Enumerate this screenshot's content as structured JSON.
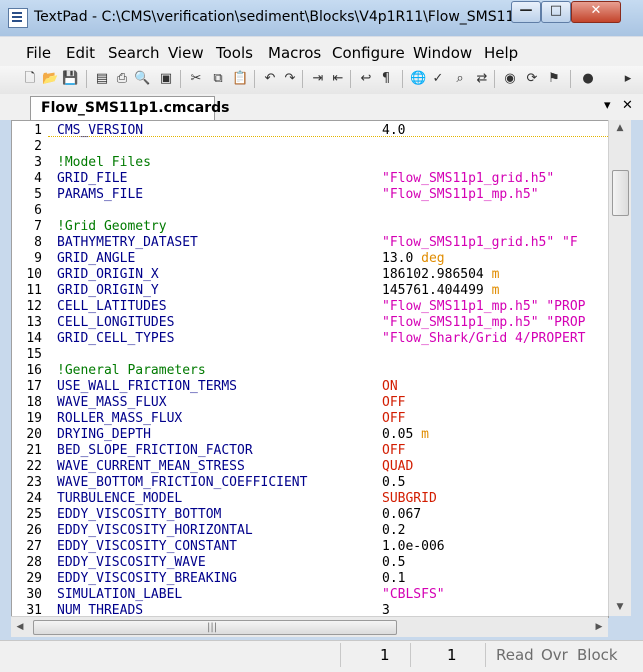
{
  "window": {
    "title": "TextPad - C:\\CMS\\verification\\sediment\\Blocks\\V4p1R11\\Flow_SMS11...",
    "controls": {
      "minimize": "—",
      "maximize": "□",
      "close": "✕"
    }
  },
  "menu": [
    "File",
    "Edit",
    "Search",
    "View",
    "Tools",
    "Macros",
    "Configure",
    "Window",
    "Help"
  ],
  "toolbar": [
    {
      "name": "new-document-icon",
      "glyph": "🗋"
    },
    {
      "name": "open-folder-icon",
      "glyph": "📂"
    },
    {
      "name": "save-icon",
      "glyph": "💾"
    },
    {
      "name": "save-all-icon",
      "glyph": "▤"
    },
    {
      "name": "print-icon",
      "glyph": "⎙"
    },
    {
      "name": "print-preview-icon",
      "glyph": "🔍"
    },
    {
      "name": "manage-files-icon",
      "glyph": "▣"
    },
    {
      "name": "cut-icon",
      "glyph": "✂"
    },
    {
      "name": "copy-icon",
      "glyph": "⧉"
    },
    {
      "name": "paste-icon",
      "glyph": "📋"
    },
    {
      "name": "undo-icon",
      "glyph": "↶"
    },
    {
      "name": "redo-icon",
      "glyph": "↷"
    },
    {
      "name": "indent-icon",
      "glyph": "⇥"
    },
    {
      "name": "outdent-icon",
      "glyph": "⇤"
    },
    {
      "name": "word-wrap-icon",
      "glyph": "↩"
    },
    {
      "name": "paragraph-icon",
      "glyph": "¶"
    },
    {
      "name": "web-browser-icon",
      "glyph": "🌐"
    },
    {
      "name": "spelling-icon",
      "glyph": "✓"
    },
    {
      "name": "find-icon",
      "glyph": "⌕"
    },
    {
      "name": "replace-icon",
      "glyph": "⇄"
    },
    {
      "name": "view-icon",
      "glyph": "◉"
    },
    {
      "name": "find-in-files-icon",
      "glyph": "⟳"
    },
    {
      "name": "bookmark-icon",
      "glyph": "⚑"
    },
    {
      "name": "bullet-icon",
      "glyph": "●"
    },
    {
      "name": "more-tools-icon",
      "glyph": "▸"
    }
  ],
  "tab": {
    "label": "Flow_SMS11p1.cmcards",
    "menu_glyph": "▾",
    "close_glyph": "✕"
  },
  "editor": {
    "lines": [
      {
        "n": "1",
        "k": "CMS_VERSION",
        "v": [
          {
            "t": "4.0",
            "c": "num"
          }
        ]
      },
      {
        "n": "2"
      },
      {
        "n": "3",
        "c": "!Model Files"
      },
      {
        "n": "4",
        "k": "GRID_FILE",
        "v": [
          {
            "t": "\"Flow_SMS11p1_grid.h5\"",
            "c": "str"
          }
        ]
      },
      {
        "n": "5",
        "k": "PARAMS_FILE",
        "v": [
          {
            "t": "\"Flow_SMS11p1_mp.h5\"",
            "c": "str"
          }
        ]
      },
      {
        "n": "6"
      },
      {
        "n": "7",
        "c": "!Grid Geometry"
      },
      {
        "n": "8",
        "k": "BATHYMETRY_DATASET",
        "v": [
          {
            "t": "\"Flow_SMS11p1_grid.h5\" \"F",
            "c": "str"
          }
        ]
      },
      {
        "n": "9",
        "k": "GRID_ANGLE",
        "v": [
          {
            "t": "13.0 ",
            "c": "num"
          },
          {
            "t": "deg",
            "c": "unit"
          }
        ]
      },
      {
        "n": "10",
        "k": "GRID_ORIGIN_X",
        "v": [
          {
            "t": "186102.986504 ",
            "c": "num"
          },
          {
            "t": "m",
            "c": "unit"
          }
        ]
      },
      {
        "n": "11",
        "k": "GRID_ORIGIN_Y",
        "v": [
          {
            "t": "145761.404499 ",
            "c": "num"
          },
          {
            "t": "m",
            "c": "unit"
          }
        ]
      },
      {
        "n": "12",
        "k": "CELL_LATITUDES",
        "v": [
          {
            "t": "\"Flow_SMS11p1_mp.h5\" \"PROP",
            "c": "str"
          }
        ]
      },
      {
        "n": "13",
        "k": "CELL_LONGITUDES",
        "v": [
          {
            "t": "\"Flow_SMS11p1_mp.h5\" \"PROP",
            "c": "str"
          }
        ]
      },
      {
        "n": "14",
        "k": "GRID_CELL_TYPES",
        "v": [
          {
            "t": "\"Flow_Shark/Grid 4/PROPERT",
            "c": "str"
          }
        ]
      },
      {
        "n": "15"
      },
      {
        "n": "16",
        "c": "!General Parameters"
      },
      {
        "n": "17",
        "k": "USE_WALL_FRICTION_TERMS",
        "v": [
          {
            "t": "ON",
            "c": "kw"
          }
        ]
      },
      {
        "n": "18",
        "k": "WAVE_MASS_FLUX",
        "v": [
          {
            "t": "OFF",
            "c": "kw"
          }
        ]
      },
      {
        "n": "19",
        "k": "ROLLER_MASS_FLUX",
        "v": [
          {
            "t": "OFF",
            "c": "kw"
          }
        ]
      },
      {
        "n": "20",
        "k": "DRYING_DEPTH",
        "v": [
          {
            "t": "0.05 ",
            "c": "num"
          },
          {
            "t": "m",
            "c": "unit"
          }
        ]
      },
      {
        "n": "21",
        "k": "BED_SLOPE_FRICTION_FACTOR",
        "v": [
          {
            "t": "OFF",
            "c": "kw"
          }
        ]
      },
      {
        "n": "22",
        "k": "WAVE_CURRENT_MEAN_STRESS",
        "v": [
          {
            "t": "QUAD",
            "c": "kw"
          }
        ]
      },
      {
        "n": "23",
        "k": "WAVE_BOTTOM_FRICTION_COEFFICIENT",
        "v": [
          {
            "t": "0.5",
            "c": "num"
          }
        ]
      },
      {
        "n": "24",
        "k": "TURBULENCE_MODEL",
        "v": [
          {
            "t": "SUBGRID",
            "c": "kw"
          }
        ]
      },
      {
        "n": "25",
        "k": "EDDY_VISCOSITY_BOTTOM",
        "v": [
          {
            "t": "0.067",
            "c": "num"
          }
        ]
      },
      {
        "n": "26",
        "k": "EDDY_VISCOSITY_HORIZONTAL",
        "v": [
          {
            "t": "0.2",
            "c": "num"
          }
        ]
      },
      {
        "n": "27",
        "k": "EDDY_VISCOSITY_CONSTANT",
        "v": [
          {
            "t": "1.0e-006",
            "c": "num"
          }
        ]
      },
      {
        "n": "28",
        "k": "EDDY_VISCOSITY_WAVE",
        "v": [
          {
            "t": "0.5",
            "c": "num"
          }
        ]
      },
      {
        "n": "29",
        "k": "EDDY_VISCOSITY_BREAKING",
        "v": [
          {
            "t": "0.1",
            "c": "num"
          }
        ]
      },
      {
        "n": "30",
        "k": "SIMULATION_LABEL",
        "v": [
          {
            "t": "\"CBLSFS\"",
            "c": "str"
          }
        ]
      },
      {
        "n": "31",
        "k": "NUM_THREADS",
        "v": [
          {
            "t": "3",
            "c": "num"
          }
        ]
      }
    ]
  },
  "scroll": {
    "up": "▲",
    "down": "▼",
    "left": "◀",
    "right": "▶",
    "grip": "|||"
  },
  "status": {
    "line": "1",
    "column": "1",
    "read": "Read",
    "ovr": "Ovr",
    "block": "Block"
  }
}
